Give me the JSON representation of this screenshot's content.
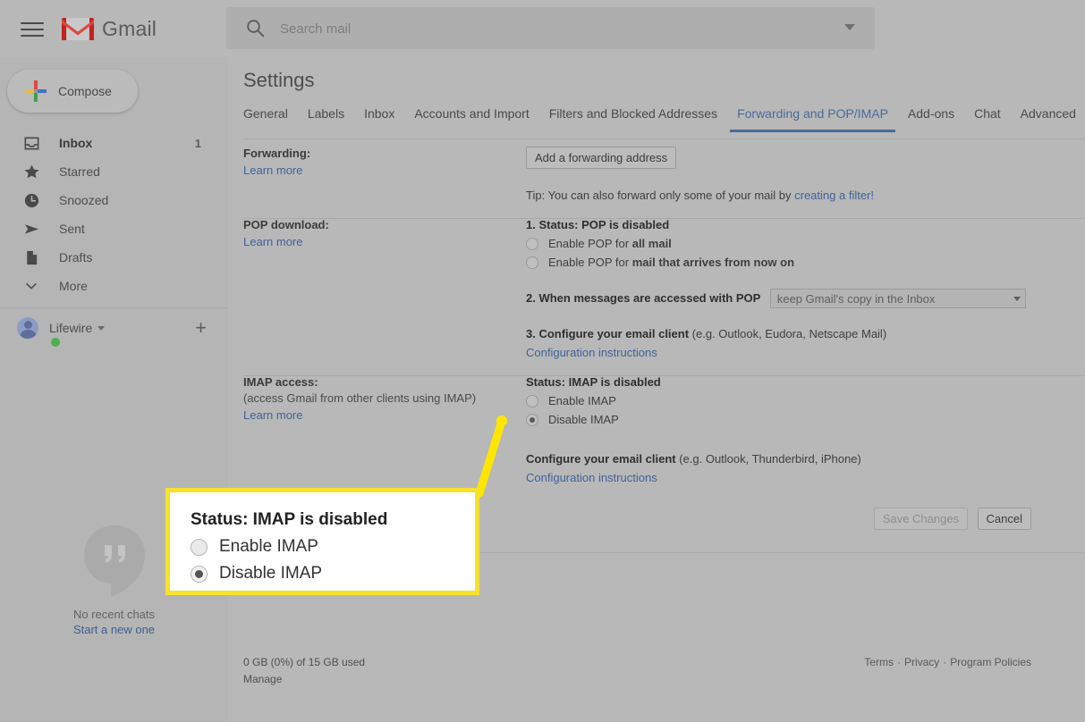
{
  "header": {
    "menu_icon": "hamburger-icon",
    "logo_icon": "gmail-logo-icon",
    "wordmark": "Gmail",
    "search": {
      "icon": "search-icon",
      "placeholder": "Search mail",
      "value": "",
      "options_icon": "chevron-down-icon"
    }
  },
  "sidebar": {
    "compose": {
      "label": "Compose",
      "icon": "plus-icon"
    },
    "items": [
      {
        "label": "Inbox",
        "icon": "inbox-icon",
        "count": "1",
        "active": true
      },
      {
        "label": "Starred",
        "icon": "star-icon",
        "count": "",
        "active": false
      },
      {
        "label": "Snoozed",
        "icon": "clock-icon",
        "count": "",
        "active": false
      },
      {
        "label": "Sent",
        "icon": "send-icon",
        "count": "",
        "active": false
      },
      {
        "label": "Drafts",
        "icon": "draft-icon",
        "count": "",
        "active": false
      },
      {
        "label": "More",
        "icon": "chevron-down-icon",
        "count": "",
        "active": false
      }
    ],
    "account": {
      "name": "Lifewire",
      "caret_icon": "chevron-down-icon",
      "add_icon": "plus-icon"
    },
    "chat": {
      "icon": "hangouts-icon",
      "empty_text": "No recent chats",
      "start_link": "Start a new one"
    }
  },
  "main": {
    "page_title": "Settings",
    "tabs": [
      {
        "label": "General",
        "active": false
      },
      {
        "label": "Labels",
        "active": false
      },
      {
        "label": "Inbox",
        "active": false
      },
      {
        "label": "Accounts and Import",
        "active": false
      },
      {
        "label": "Filters and Blocked Addresses",
        "active": false
      },
      {
        "label": "Forwarding and POP/IMAP",
        "active": true
      },
      {
        "label": "Add-ons",
        "active": false
      },
      {
        "label": "Chat",
        "active": false
      },
      {
        "label": "Advanced",
        "active": false
      }
    ],
    "forwarding": {
      "title": "Forwarding:",
      "learn_more": "Learn more",
      "add_button": "Add a forwarding address",
      "tip_prefix": "Tip: You can also forward only some of your mail by ",
      "tip_link": "creating a filter!"
    },
    "pop": {
      "title": "POP download:",
      "learn_more": "Learn more",
      "status": "1. Status: POP is disabled",
      "option1_prefix": "Enable POP for ",
      "option1_bold": "all mail",
      "option1_checked": false,
      "option2_prefix": "Enable POP for ",
      "option2_bold": "mail that arrives from now on",
      "option2_checked": false,
      "step2_label": "2. When messages are accessed with POP",
      "step2_select_value": "keep Gmail's copy in the Inbox",
      "step2_select_caret": "chevron-down-icon",
      "step3_bold": "3. Configure your email client",
      "step3_rest": " (e.g. Outlook, Eudora, Netscape Mail)",
      "step3_link": "Configuration instructions"
    },
    "imap": {
      "title": "IMAP access:",
      "subtitle": "(access Gmail from other clients using IMAP)",
      "learn_more": "Learn more",
      "status": "Status: IMAP is disabled",
      "enable_label": "Enable IMAP",
      "enable_checked": false,
      "disable_label": "Disable IMAP",
      "disable_checked": true,
      "configure_bold": "Configure your email client",
      "configure_rest": " (e.g. Outlook, Thunderbird, iPhone)",
      "configure_link": "Configuration instructions"
    },
    "actions": {
      "save_label": "Save Changes",
      "save_disabled": true,
      "cancel_label": "Cancel"
    },
    "footer": {
      "storage": "0 GB (0%) of 15 GB used",
      "manage": "Manage",
      "terms": "Terms",
      "privacy": "Privacy",
      "policies": "Program Policies",
      "separator": "·"
    }
  },
  "callout": {
    "title": "Status: IMAP is disabled",
    "enable_label": "Enable IMAP",
    "enable_checked": false,
    "disable_label": "Disable IMAP",
    "disable_checked": true,
    "border_color": "#f7e22c",
    "pointer_color": "#ffe600"
  }
}
